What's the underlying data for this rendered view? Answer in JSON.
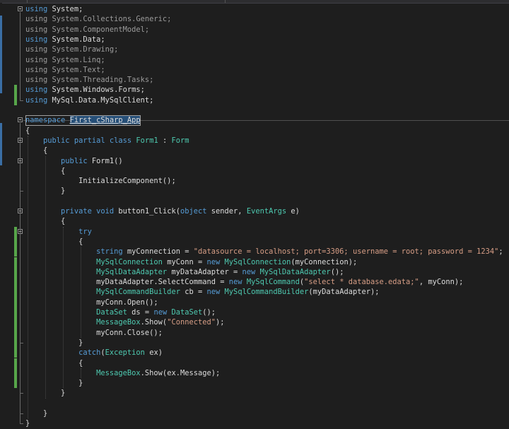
{
  "editor": {
    "language": "C#",
    "namespace_name": "First_cSharp_App",
    "colors": {
      "background": "#1e1e1e",
      "keyword": "#569cd6",
      "type": "#4ec9b0",
      "string": "#d69d85",
      "change_marker": "#57a64a"
    },
    "lines": [
      [
        [
          "kw",
          "using"
        ],
        [
          "p",
          " System;"
        ]
      ],
      [
        [
          "gr",
          "using System.Collections.Generic;"
        ]
      ],
      [
        [
          "gr",
          "using System.ComponentModel;"
        ]
      ],
      [
        [
          "kw",
          "using"
        ],
        [
          "p",
          " System.Data;"
        ]
      ],
      [
        [
          "gr",
          "using System.Drawing;"
        ]
      ],
      [
        [
          "gr",
          "using System.Linq;"
        ]
      ],
      [
        [
          "gr",
          "using System.Text;"
        ]
      ],
      [
        [
          "gr",
          "using System.Threading.Tasks;"
        ]
      ],
      [
        [
          "kw",
          "using"
        ],
        [
          "p",
          " System.Windows.Forms;"
        ]
      ],
      [
        [
          "kw",
          "using"
        ],
        [
          "p",
          " MySql.Data.MySqlClient;"
        ]
      ],
      [],
      [
        [
          "kw",
          "namespace"
        ],
        [
          "p",
          " "
        ],
        [
          "ns",
          "First_cSharp_App"
        ]
      ],
      [
        [
          "p",
          "{"
        ]
      ],
      [
        [
          "p",
          "    "
        ],
        [
          "kw",
          "public partial class"
        ],
        [
          "p",
          " "
        ],
        [
          "ty",
          "Form1"
        ],
        [
          "p",
          " : "
        ],
        [
          "ty",
          "Form"
        ]
      ],
      [
        [
          "p",
          "    {"
        ]
      ],
      [
        [
          "p",
          "        "
        ],
        [
          "kw",
          "public"
        ],
        [
          "p",
          " Form1()"
        ]
      ],
      [
        [
          "p",
          "        {"
        ]
      ],
      [
        [
          "p",
          "            InitializeComponent();"
        ]
      ],
      [
        [
          "p",
          "        }"
        ]
      ],
      [],
      [
        [
          "p",
          "        "
        ],
        [
          "kw",
          "private void"
        ],
        [
          "p",
          " button1_Click("
        ],
        [
          "kw",
          "object"
        ],
        [
          "p",
          " sender, "
        ],
        [
          "ty",
          "EventArgs"
        ],
        [
          "p",
          " e)"
        ]
      ],
      [
        [
          "p",
          "        {"
        ]
      ],
      [
        [
          "p",
          "            "
        ],
        [
          "kw",
          "try"
        ]
      ],
      [
        [
          "p",
          "            {"
        ]
      ],
      [
        [
          "p",
          "                "
        ],
        [
          "kw",
          "string"
        ],
        [
          "p",
          " myConnection = "
        ],
        [
          "str",
          "\"datasource = localhost; port=3306; username = root; password = 1234\""
        ],
        [
          "p",
          ";"
        ]
      ],
      [
        [
          "p",
          "                "
        ],
        [
          "ty",
          "MySqlConnection"
        ],
        [
          "p",
          " myConn = "
        ],
        [
          "kw",
          "new"
        ],
        [
          "p",
          " "
        ],
        [
          "ty",
          "MySqlConnection"
        ],
        [
          "p",
          "(myConnection);"
        ]
      ],
      [
        [
          "p",
          "                "
        ],
        [
          "ty",
          "MySqlDataAdapter"
        ],
        [
          "p",
          " myDataAdapter = "
        ],
        [
          "kw",
          "new"
        ],
        [
          "p",
          " "
        ],
        [
          "ty",
          "MySqlDataAdapter"
        ],
        [
          "p",
          "();"
        ]
      ],
      [
        [
          "p",
          "                myDataAdapter.SelectCommand = "
        ],
        [
          "kw",
          "new"
        ],
        [
          "p",
          " "
        ],
        [
          "ty",
          "MySqlCommand"
        ],
        [
          "p",
          "("
        ],
        [
          "str",
          "\"select * database.edata;\""
        ],
        [
          "p",
          ", myConn);"
        ]
      ],
      [
        [
          "p",
          "                "
        ],
        [
          "ty",
          "MySqlCommandBuilder"
        ],
        [
          "p",
          " cb = "
        ],
        [
          "kw",
          "new"
        ],
        [
          "p",
          " "
        ],
        [
          "ty",
          "MySqlCommandBuilder"
        ],
        [
          "p",
          "(myDataAdapter);"
        ]
      ],
      [
        [
          "p",
          "                myConn.Open();"
        ]
      ],
      [
        [
          "p",
          "                "
        ],
        [
          "ty",
          "DataSet"
        ],
        [
          "p",
          " ds = "
        ],
        [
          "kw",
          "new"
        ],
        [
          "p",
          " "
        ],
        [
          "ty",
          "DataSet"
        ],
        [
          "p",
          "();"
        ]
      ],
      [
        [
          "p",
          "                "
        ],
        [
          "ty",
          "MessageBox"
        ],
        [
          "p",
          ".Show("
        ],
        [
          "str",
          "\"Connected\""
        ],
        [
          "p",
          ");"
        ]
      ],
      [
        [
          "p",
          "                myConn.Close();"
        ]
      ],
      [
        [
          "p",
          "            }"
        ]
      ],
      [
        [
          "p",
          "            "
        ],
        [
          "kw",
          "catch"
        ],
        [
          "p",
          "("
        ],
        [
          "ty",
          "Exception"
        ],
        [
          "p",
          " ex)"
        ]
      ],
      [
        [
          "p",
          "            {"
        ]
      ],
      [
        [
          "p",
          "                "
        ],
        [
          "ty",
          "MessageBox"
        ],
        [
          "p",
          ".Show(ex.Message);"
        ]
      ],
      [
        [
          "p",
          "            }"
        ]
      ],
      [
        [
          "p",
          "        }"
        ]
      ],
      [],
      [
        [
          "p",
          "    }"
        ]
      ],
      [
        [
          "p",
          "}"
        ]
      ]
    ]
  }
}
